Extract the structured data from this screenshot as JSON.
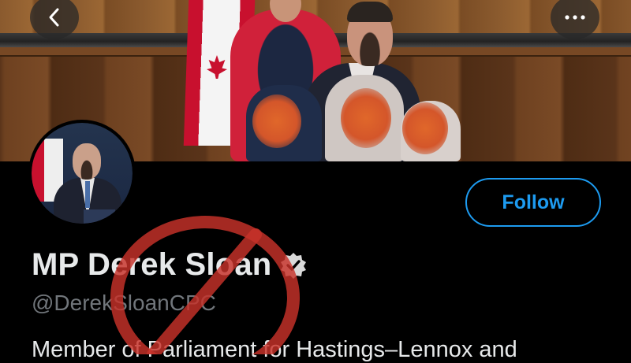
{
  "navigation": {
    "back_icon": "chevron-left-icon",
    "more_icon": "more-horizontal-icon"
  },
  "profile": {
    "display_name": "MP Derek Sloan",
    "verified_icon": "verified-badge-icon",
    "handle": "@DerekSloanCPC",
    "bio": "Member of Parliament for Hastings–Lennox and",
    "follow_label": "Follow"
  },
  "colors": {
    "background": "#000000",
    "accent": "#1d9bf0",
    "secondary_text": "#71767b",
    "stamp": "#c8322a"
  }
}
